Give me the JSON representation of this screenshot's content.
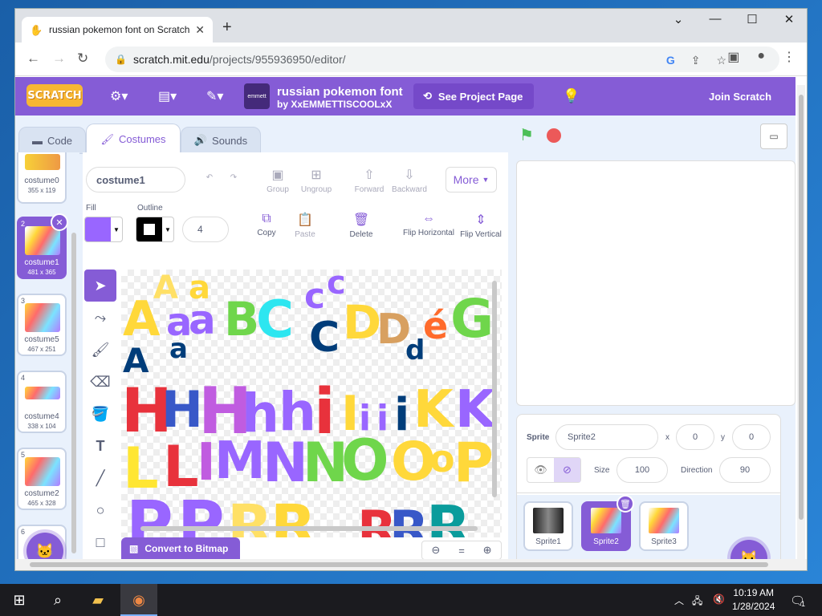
{
  "browser": {
    "tab_title": "russian pokemon font on Scratch",
    "url_host": "scratch.mit.edu",
    "url_path": "/projects/955936950/editor/",
    "new_tab": "+",
    "minimize": "⌄",
    "restore": "—",
    "maximize": "☐",
    "close": "✕"
  },
  "scratch": {
    "logo": "SCRATCH",
    "project_title": "russian pokemon font",
    "project_by": "by XxEMMETTISCOOLxX",
    "see_project": "See Project Page",
    "join": "Join Scratch",
    "thumb_label": "emmett",
    "tabs": {
      "code": "Code",
      "costumes": "Costumes",
      "sounds": "Sounds"
    },
    "costumes": [
      {
        "num": "",
        "name": "costume0",
        "size": "355 x 119"
      },
      {
        "num": "2",
        "name": "costume1",
        "size": "481 x 365",
        "selected": true
      },
      {
        "num": "3",
        "name": "costume5",
        "size": "467 x 251"
      },
      {
        "num": "4",
        "name": "costume4",
        "size": "338 x 104"
      },
      {
        "num": "5",
        "name": "costume2",
        "size": "465 x 328"
      },
      {
        "num": "6",
        "name": "",
        "size": ""
      }
    ],
    "editor": {
      "costume_name": "costume1",
      "group": "Group",
      "ungroup": "Ungroup",
      "forward": "Forward",
      "backward": "Backward",
      "more": "More",
      "fill_label": "Fill",
      "outline_label": "Outline",
      "outline_width": "4",
      "copy": "Copy",
      "paste": "Paste",
      "delete": "Delete",
      "flip_h": "Flip Horizontal",
      "flip_v": "Flip Vertical",
      "convert": "Convert to Bitmap",
      "fill_color": "#9966ff"
    },
    "sprite_info": {
      "sprite_label": "Sprite",
      "sprite_name": "Sprite2",
      "x_label": "x",
      "x": "0",
      "y_label": "y",
      "y": "0",
      "show_label": "Show",
      "size_label": "Size",
      "size": "100",
      "direction_label": "Direction",
      "direction": "90"
    },
    "sprites": [
      {
        "name": "Sprite1"
      },
      {
        "name": "Sprite2",
        "selected": true
      },
      {
        "name": "Sprite3"
      }
    ],
    "accent": "#855cd6"
  },
  "taskbar": {
    "time": "10:19 AM",
    "date": "1/28/2024",
    "notifications": "1"
  }
}
